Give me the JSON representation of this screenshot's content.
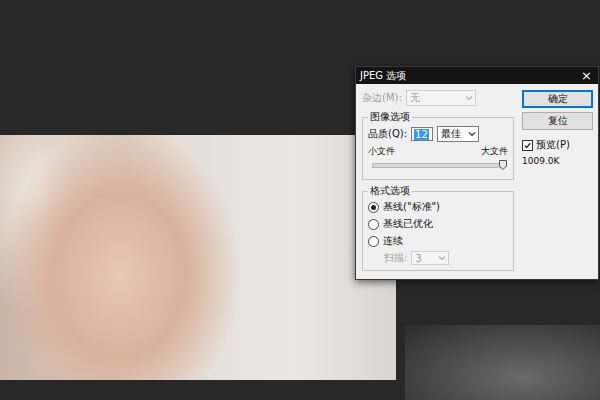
{
  "dialog": {
    "title": "JPEG 选项",
    "close": "×"
  },
  "matte": {
    "label": "杂边(M):",
    "value": "无",
    "disabled": true
  },
  "image_options": {
    "title": "图像选项",
    "quality_label": "品质(Q):",
    "quality_value": "12",
    "quality_selected": true,
    "quality_preset": "最佳",
    "small_label": "小文件",
    "large_label": "大文件",
    "level": 1
  },
  "format_options": {
    "title": "格式选项",
    "radios": [
      {
        "label": "基线(\"标准\")",
        "selected": true
      },
      {
        "label": "基线已优化",
        "selected": false
      },
      {
        "label": "连续",
        "selected": false
      }
    ],
    "scans": {
      "label": "扫描:",
      "value": "3",
      "disabled": true
    }
  },
  "buttons": [
    {
      "label": "确定",
      "default": true
    },
    {
      "label": "复位",
      "default": false
    }
  ],
  "preview": {
    "label": "预览(P)",
    "checked": true
  },
  "file_size": "1009.0K"
}
